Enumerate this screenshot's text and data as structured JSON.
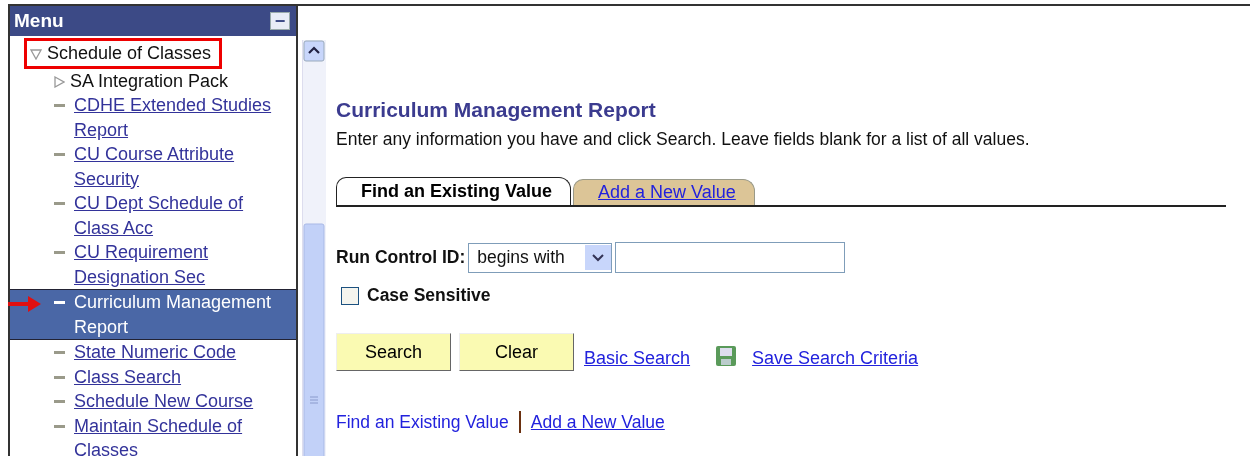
{
  "menu": {
    "title": "Menu",
    "collapse_button": "−",
    "items": [
      {
        "label": "Schedule of Classes",
        "kind": "folder",
        "expanded": true,
        "selected": false,
        "boxed": true,
        "children": [
          {
            "label": "SA Integration Pack",
            "kind": "folder",
            "expanded": false,
            "selected": false
          },
          {
            "label": "CDHE Extended Studies Report",
            "kind": "link",
            "selected": false
          },
          {
            "label": "CU Course Attribute Security",
            "kind": "link",
            "selected": false
          },
          {
            "label": "CU Dept Schedule of Class Acc",
            "kind": "link",
            "selected": false
          },
          {
            "label": "CU Requirement Designation Sec",
            "kind": "link",
            "selected": false
          },
          {
            "label": "Curriculum Management Report",
            "kind": "link",
            "selected": true,
            "arrow": true
          },
          {
            "label": "State Numeric Code",
            "kind": "link",
            "selected": false
          },
          {
            "label": "Class Search",
            "kind": "link",
            "selected": false
          },
          {
            "label": "Schedule New Course",
            "kind": "link",
            "selected": false
          },
          {
            "label": "Maintain Schedule of Classes",
            "kind": "link",
            "selected": false
          }
        ]
      }
    ]
  },
  "page": {
    "title": "Curriculum Management Report",
    "instructions": "Enter any information you have and click Search. Leave fields blank for a list of all values.",
    "tabs": [
      {
        "label": "Find an Existing Value",
        "selected": true
      },
      {
        "label": "Add a New Value",
        "selected": false
      }
    ],
    "run_control": {
      "label": "Run Control ID:",
      "operator": "begins with"
    },
    "case_sensitive": {
      "label": "Case Sensitive",
      "checked": false
    },
    "buttons": [
      "Search",
      "Clear"
    ],
    "links": [
      {
        "label": "Basic Search",
        "kind": "link"
      },
      {
        "label": "Save Search Criteria",
        "kind": "save"
      }
    ],
    "bottom_links": [
      "Find an Existing Value",
      "Add a New Value"
    ]
  }
}
